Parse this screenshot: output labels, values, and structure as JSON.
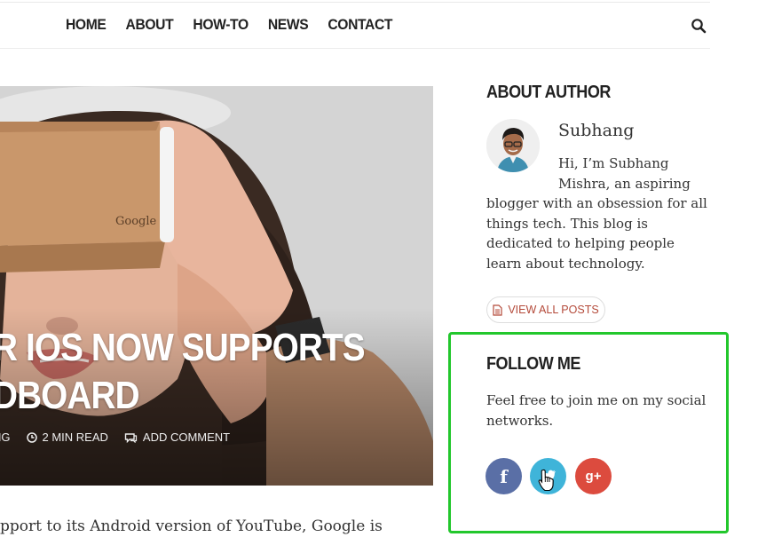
{
  "nav": {
    "items": [
      "HOME",
      "ABOUT",
      "HOW-TO",
      "NEWS",
      "CONTACT"
    ],
    "search_icon": "search-icon"
  },
  "hero": {
    "title_line1": "R IOS NOW SUPPORTS",
    "title_line2": "DBOARD",
    "meta_category": "NG",
    "read_time": "2 MIN READ",
    "comment": "ADD COMMENT",
    "brand_on_viewer": "Google"
  },
  "excerpt": "pport to its Android version of YouTube, Google is",
  "about": {
    "title": "ABOUT AUTHOR",
    "name": "Subhang",
    "bio_line1": "Hi, I’m Subhang",
    "bio_line2": "Mishra, an aspiring",
    "bio_rest": "blogger with an obsession for all things tech. This blog is dedicated to helping people learn about technology.",
    "view_all_label": "VIEW ALL POSTS"
  },
  "follow": {
    "title": "FOLLOW ME",
    "text": "Feel free to join me on my social networks.",
    "highlight_color": "#22c72c",
    "networks": [
      {
        "name": "facebook",
        "glyph": "f",
        "color": "#5a6fa6"
      },
      {
        "name": "twitter",
        "glyph": "",
        "color": "#3fb4d9"
      },
      {
        "name": "google-plus",
        "glyph": "g+",
        "color": "#dc4b3e"
      }
    ]
  }
}
